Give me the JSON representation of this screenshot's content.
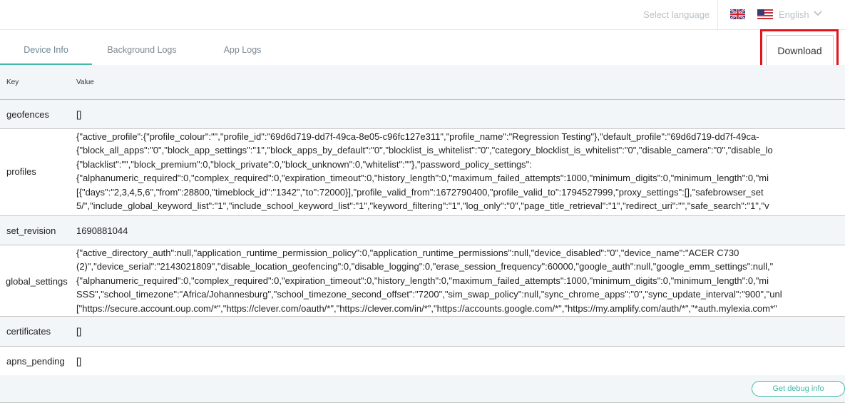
{
  "header": {
    "select_language_label": "Select language",
    "current_language": "English"
  },
  "tabs": [
    {
      "label": "Device Info",
      "active": true
    },
    {
      "label": "Background Logs",
      "active": false
    },
    {
      "label": "App Logs",
      "active": false
    }
  ],
  "download_label": "Download",
  "table": {
    "headers": {
      "key": "Key",
      "value": "Value"
    },
    "rows": {
      "geofences": {
        "key": "geofences",
        "value": "[]"
      },
      "profiles": {
        "key": "profiles",
        "lines": [
          "{\"active_profile\":{\"profile_colour\":\"\",\"profile_id\":\"69d6d719-dd7f-49ca-8e05-c96fc127e311\",\"profile_name\":\"Regression Testing\"},\"default_profile\":\"69d6d719-dd7f-49ca-",
          "{\"block_all_apps\":\"0\",\"block_app_settings\":\"1\",\"block_apps_by_default\":\"0\",\"blocklist_is_whitelist\":\"0\",\"category_blocklist_is_whitelist\":\"0\",\"disable_camera\":\"0\",\"disable_lo",
          "{\"blacklist\":\"\",\"block_premium\":0,\"block_private\":0,\"block_unknown\":0,\"whitelist\":\"\"},\"password_policy_settings\":",
          "{\"alphanumeric_required\":0,\"complex_required\":0,\"expiration_timeout\":0,\"history_length\":0,\"maximum_failed_attempts\":1000,\"minimum_digits\":0,\"minimum_length\":0,\"mi",
          "[{\"days\":\"2,3,4,5,6\",\"from\":28800,\"timeblock_id\":\"1342\",\"to\":72000}],\"profile_valid_from\":1672790400,\"profile_valid_to\":1794527999,\"proxy_settings\":[],\"safebrowser_set",
          "5/\",\"include_global_keyword_list\":\"1\",\"include_school_keyword_list\":\"1\",\"keyword_filtering\":\"1\",\"log_only\":\"0\",\"page_title_retrieval\":\"1\",\"redirect_uri\":\"\",\"safe_search\":\"1\",\"v"
        ]
      },
      "set_revision": {
        "key": "set_revision",
        "value": "1690881044"
      },
      "global_settings": {
        "key": "global_settings",
        "lines": [
          "{\"active_directory_auth\":null,\"application_runtime_permission_policy\":0,\"application_runtime_permissions\":null,\"device_disabled\":\"0\",\"device_name\":\"ACER C730",
          "(2)\",\"device_serial\":\"2143021809\",\"disable_location_geofencing\":0,\"disable_logging\":0,\"erase_session_frequency\":60000,\"google_auth\":null,\"google_emm_settings\":null,\"",
          "{\"alphanumeric_required\":0,\"complex_required\":0,\"expiration_timeout\":0,\"history_length\":0,\"maximum_failed_attempts\":1000,\"minimum_digits\":0,\"minimum_length\":0,\"mi",
          "SSS\",\"school_timezone\":\"Africa/Johannesburg\",\"school_timezone_second_offset\":\"7200\",\"sim_swap_policy\":null,\"sync_chrome_apps\":\"0\",\"sync_update_interval\":\"900\",\"unl",
          "[\"https://secure.account.oup.com/*\",\"https://clever.com/oauth/*\",\"https://clever.com/in/*\",\"https://accounts.google.com/*\",\"https://my.amplify.com/auth/*\",\"*auth.mylexia.com*\""
        ]
      },
      "certificates": {
        "key": "certificates",
        "value": "[]"
      },
      "apns_pending": {
        "key": "apns_pending",
        "value": "[]"
      }
    }
  },
  "debug_label": "Get debug info",
  "colors": {
    "accent": "#45b8a8",
    "highlight": "#e3141b",
    "row_alt": "#f3f6f8"
  }
}
